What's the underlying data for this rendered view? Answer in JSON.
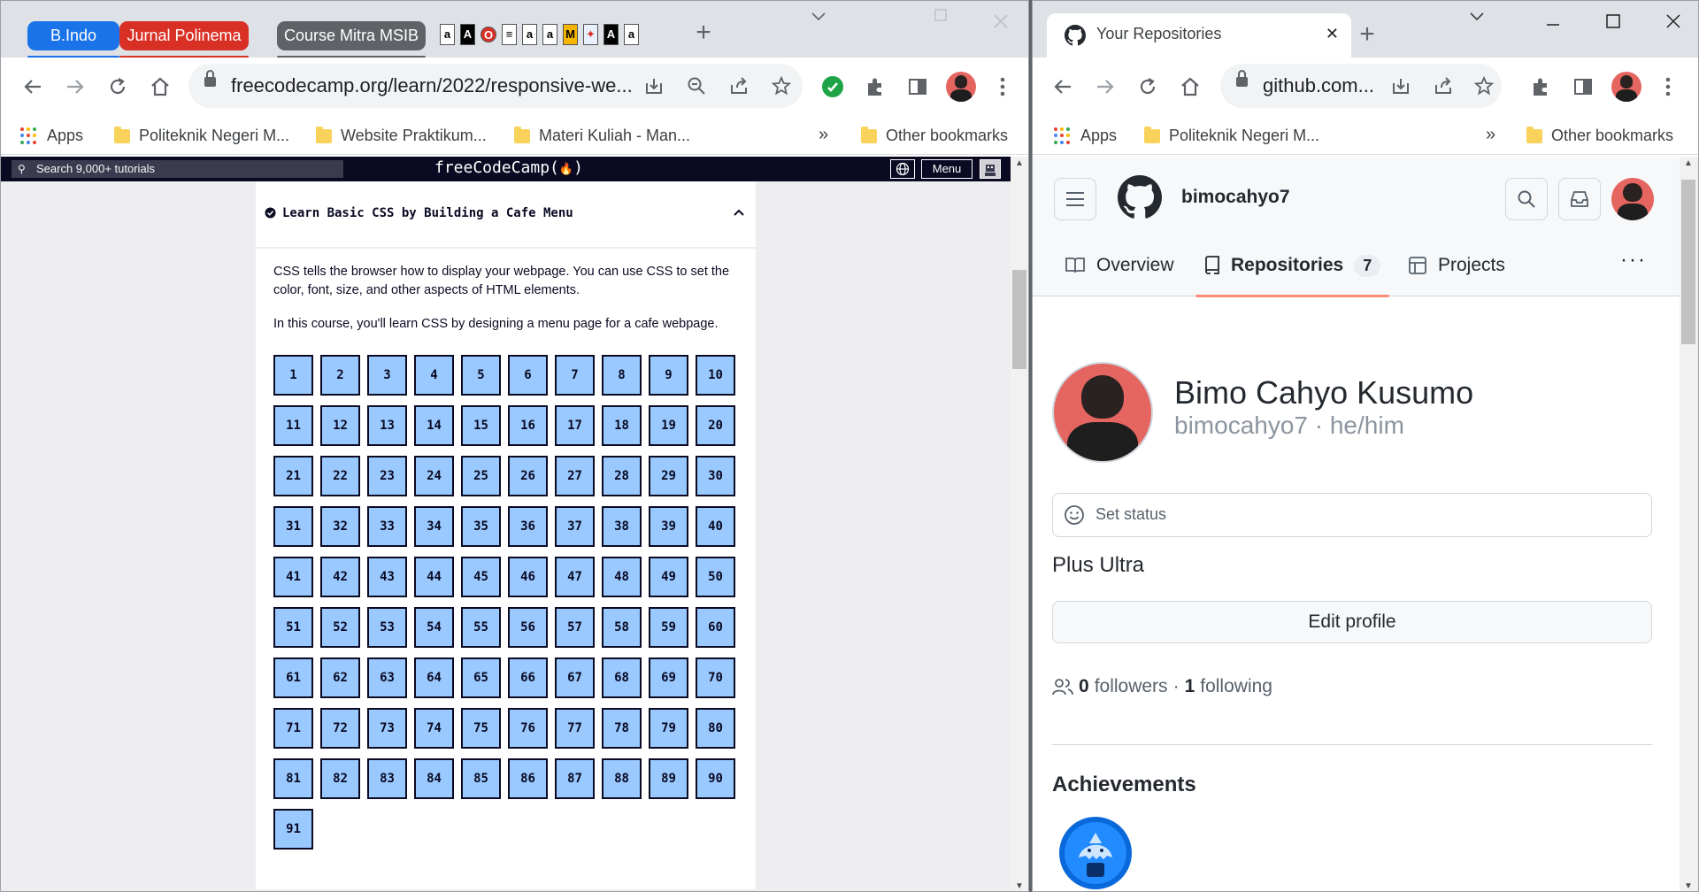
{
  "left": {
    "tab_groups": [
      "B.Indo",
      "Jurnal Polinema",
      "Course Mitra MSIB"
    ],
    "tab_favicons": [
      "a",
      "A",
      "O",
      "≡",
      "a",
      "a",
      "M",
      "✦",
      "A",
      "a"
    ],
    "new_tab": "+",
    "url": "freecodecamp.org/learn/2022/responsive-we...",
    "bookmarks": {
      "apps": "Apps",
      "items": [
        "Politeknik Negeri M...",
        "Website Praktikum...",
        "Materi Kuliah - Man..."
      ],
      "overflow": "»",
      "other": "Other bookmarks"
    },
    "fcc": {
      "search_placeholder": "Search 9,000+ tutorials",
      "logo": "freeCodeCamp(🔥)",
      "logo_text": "freeCodeCamp(",
      "logo_flame": "🔥",
      "logo_close": ")",
      "menu": "Menu",
      "block_title": "Learn Basic CSS by Building a Cafe Menu",
      "intro_1": "CSS tells the browser how to display your webpage. You can use CSS to set the color, font, size, and other aspects of HTML elements.",
      "intro_2": "In this course, you'll learn CSS by designing a menu page for a cafe webpage.",
      "steps": [
        "1",
        "2",
        "3",
        "4",
        "5",
        "6",
        "7",
        "8",
        "9",
        "10",
        "11",
        "12",
        "13",
        "14",
        "15",
        "16",
        "17",
        "18",
        "19",
        "20",
        "21",
        "22",
        "23",
        "24",
        "25",
        "26",
        "27",
        "28",
        "29",
        "30",
        "31",
        "32",
        "33",
        "34",
        "35",
        "36",
        "37",
        "38",
        "39",
        "40",
        "41",
        "42",
        "43",
        "44",
        "45",
        "46",
        "47",
        "48",
        "49",
        "50",
        "51",
        "52",
        "53",
        "54",
        "55",
        "56",
        "57",
        "58",
        "59",
        "60",
        "61",
        "62",
        "63",
        "64",
        "65",
        "66",
        "67",
        "68",
        "69",
        "70",
        "71",
        "72",
        "73",
        "74",
        "75",
        "76",
        "77",
        "78",
        "79",
        "80",
        "81",
        "82",
        "83",
        "84",
        "85",
        "86",
        "87",
        "88",
        "89",
        "90",
        "91"
      ]
    }
  },
  "right": {
    "tab_title": "Your Repositories",
    "tab_close": "✕",
    "new_tab": "+",
    "url": "github.com...",
    "bookmarks": {
      "apps": "Apps",
      "items": [
        "Politeknik Negeri M..."
      ],
      "overflow": "»",
      "other": "Other bookmarks"
    },
    "github": {
      "username": "bimocahyo7",
      "tabs": {
        "overview": "Overview",
        "repositories": "Repositories",
        "repo_count": "7",
        "projects": "Projects"
      },
      "more": "···",
      "full_name": "Bimo Cahyo Kusumo",
      "login_pronouns": "bimocahyo7 · he/him",
      "set_status": "Set status",
      "bio": "Plus Ultra",
      "edit_profile": "Edit profile",
      "followers_count": "0",
      "followers_label": "followers",
      "sep": "·",
      "following_count": "1",
      "following_label": "following",
      "achievements": "Achievements"
    }
  },
  "colors": {
    "fcc_dark": "#0a0a23",
    "fcc_step": "#99c9ff",
    "gh_underline": "#fd8c73",
    "group_blue": "#1a73e8",
    "group_red": "#d93025",
    "group_gray": "#5f6368"
  }
}
